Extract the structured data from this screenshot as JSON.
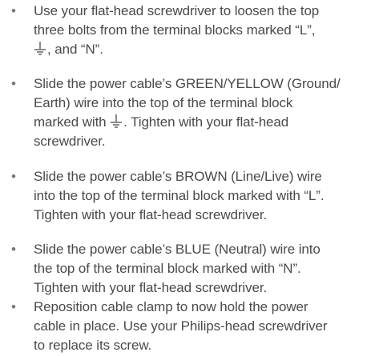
{
  "bullet": "•",
  "steps": [
    {
      "lines": [
        "Use your flat-head screwdriver to loosen the top",
        "three bolts from the terminal blocks marked “L”,",
        ", and “N”."
      ]
    },
    {
      "lines": [
        "Slide the power cable’s GREEN/YELLOW (Ground/",
        "Earth) wire into the top of the terminal block",
        "marked with ",
        ". Tighten with your flat-head",
        "screwdriver."
      ]
    },
    {
      "lines": [
        "Slide the power cable’s BROWN (Line/Live) wire",
        "into the top of the terminal block marked with “L”.",
        "Tighten with your flat-head screwdriver."
      ]
    },
    {
      "lines": [
        "Slide the power cable’s BLUE (Neutral) wire into",
        "the top of the terminal block marked with “N”.",
        "Tighten with your flat-head screwdriver."
      ]
    },
    {
      "lines": [
        "Reposition cable clamp to now hold the power",
        "cable in place. Use your Philips-head screwdriver",
        "to replace its screw."
      ]
    }
  ],
  "icons": {
    "ground": "ground-symbol-icon"
  },
  "colors": {
    "text": "#4a4a4a",
    "bullet": "#777777",
    "ground_icon": "#8a8a8a"
  }
}
